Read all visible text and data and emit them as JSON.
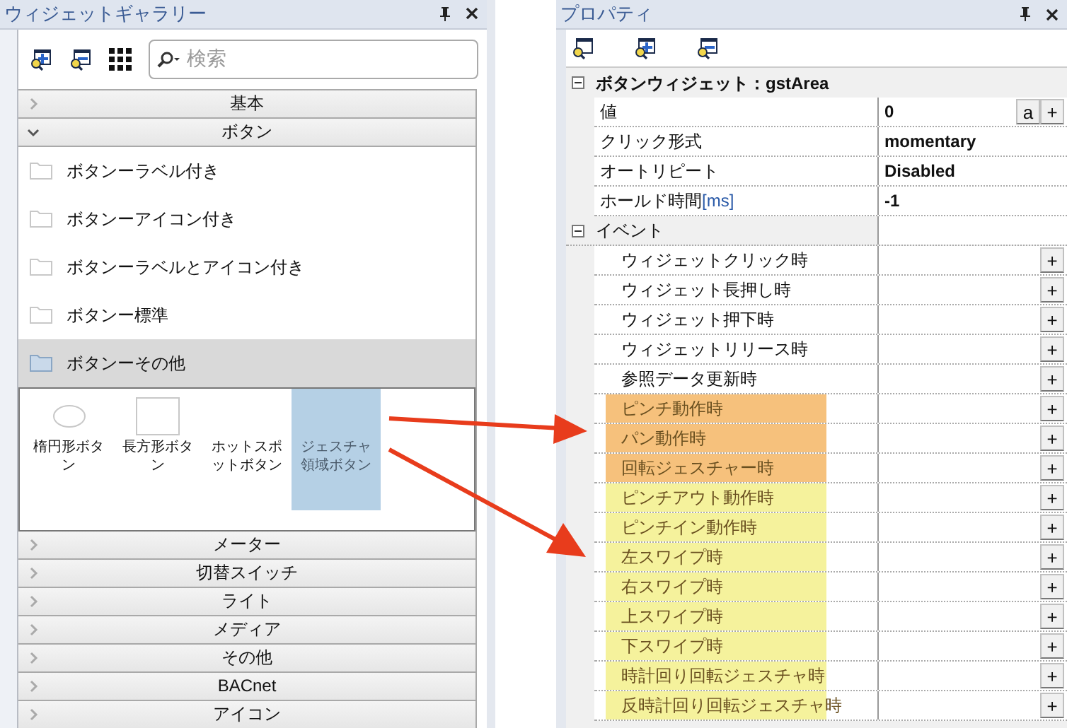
{
  "gallery": {
    "title": "ウィジェットギャラリー",
    "search": {
      "placeholder": "検索"
    },
    "categories_top": [
      {
        "label": "基本",
        "expanded": false
      },
      {
        "label": "ボタン",
        "expanded": true
      }
    ],
    "folders": [
      {
        "label": "ボタンーラベル付き",
        "selected": false
      },
      {
        "label": "ボタンーアイコン付き",
        "selected": false
      },
      {
        "label": "ボタンーラベルとアイコン付き",
        "selected": false
      },
      {
        "label": "ボタンー標準",
        "selected": false
      },
      {
        "label": "ボタンーその他",
        "selected": true
      }
    ],
    "widgets": [
      {
        "label": "楕円形ボタン",
        "kind": "ellipse",
        "selected": false
      },
      {
        "label": "長方形ボタン",
        "kind": "rectangle",
        "selected": false
      },
      {
        "label": "ホットスポットボタン",
        "kind": "plain",
        "selected": false
      },
      {
        "label": "ジェスチャ領域ボタン",
        "kind": "plain",
        "selected": true
      }
    ],
    "categories_bottom": [
      {
        "label": "メーター",
        "expanded": false
      },
      {
        "label": "切替スイッチ",
        "expanded": false
      },
      {
        "label": "ライト",
        "expanded": false
      },
      {
        "label": "メディア",
        "expanded": false
      },
      {
        "label": "その他",
        "expanded": false
      },
      {
        "label": "BACnet",
        "expanded": false
      },
      {
        "label": "アイコン",
        "expanded": false
      }
    ]
  },
  "properties": {
    "title": "プロパティ",
    "group": {
      "label": "ボタンウィジェット：gstArea",
      "expanded": true
    },
    "rows": [
      {
        "name": "値",
        "value": "0",
        "buttons": [
          "a",
          "+"
        ]
      },
      {
        "name": "クリック形式",
        "value": "momentary"
      },
      {
        "name": "オートリピート",
        "value": "Disabled"
      },
      {
        "name": "ホールド時間",
        "unit": "[ms]",
        "value": "-1"
      }
    ],
    "events_group": {
      "label": "イベント",
      "expanded": true
    },
    "events": [
      {
        "name": "ウィジェットクリック時",
        "button": "+"
      },
      {
        "name": "ウィジェット長押し時",
        "button": "+"
      },
      {
        "name": "ウィジェット押下時",
        "button": "+"
      },
      {
        "name": "ウィジェットリリース時",
        "button": "+"
      },
      {
        "name": "参照データ更新時",
        "button": "+"
      },
      {
        "name": "ピンチ動作時",
        "button": "+",
        "color": "#f6c17c"
      },
      {
        "name": "パン動作時",
        "button": "+",
        "color": "#f6c17c"
      },
      {
        "name": "回転ジェスチャー時",
        "button": "+",
        "color": "#f6c17c"
      },
      {
        "name": "ピンチアウト動作時",
        "button": "+",
        "color": "#f5f29c"
      },
      {
        "name": "ピンチイン動作時",
        "button": "+",
        "color": "#f5f29c"
      },
      {
        "name": "左スワイプ時",
        "button": "+",
        "color": "#f5f29c"
      },
      {
        "name": "右スワイプ時",
        "button": "+",
        "color": "#f5f29c"
      },
      {
        "name": "上スワイプ時",
        "button": "+",
        "color": "#f5f29c"
      },
      {
        "name": "下スワイプ時",
        "button": "+",
        "color": "#f5f29c"
      },
      {
        "name": "時計回り回転ジェスチャ時",
        "button": "+",
        "color": "#f5f29c"
      },
      {
        "name": "反時計回り回転ジェスチャ時",
        "button": "+",
        "color": "#f5f29c"
      }
    ]
  }
}
